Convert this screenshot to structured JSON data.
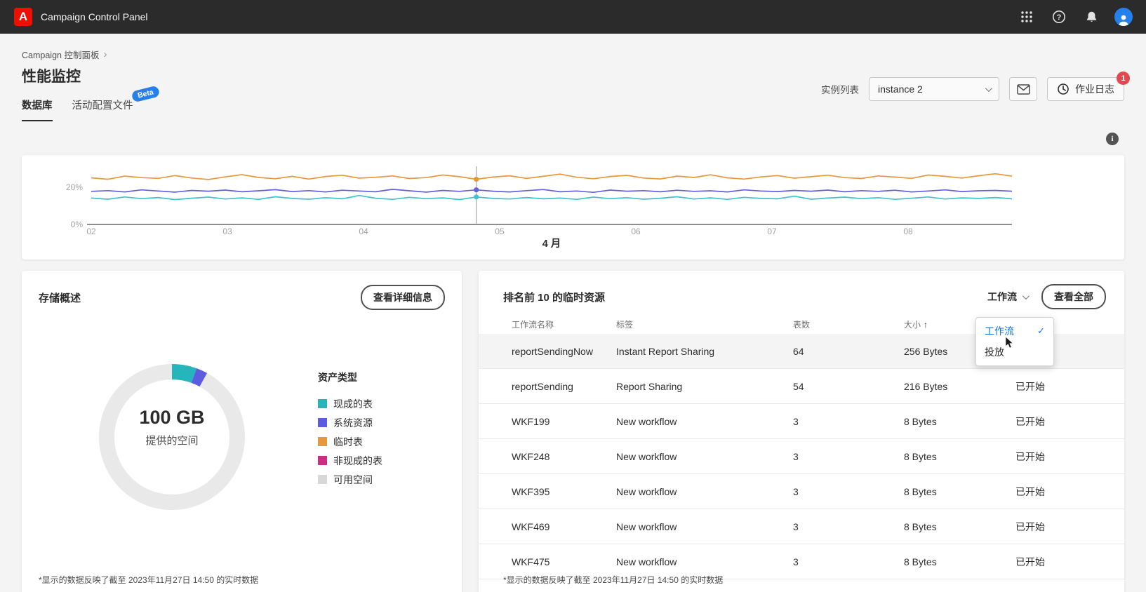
{
  "topbar": {
    "app_title": "Campaign Control Panel"
  },
  "header": {
    "breadcrumb": "Campaign 控制面板",
    "title": "性能监控",
    "tabs": [
      {
        "label": "数据库",
        "active": true
      },
      {
        "label": "活动配置文件",
        "badge": "Beta"
      }
    ],
    "instance_label": "实例列表",
    "instance_value": "instance 2",
    "jobs_button": "作业日志",
    "jobs_badge": "1"
  },
  "chart_data": {
    "type": "line",
    "xlabel": "4 月",
    "x_tick_labels": [
      "02",
      "03",
      "04",
      "05",
      "06",
      "07",
      "08"
    ],
    "y_tick_labels": [
      "20%",
      "0%"
    ],
    "y_ticks": [
      20,
      0
    ],
    "ylim": [
      0,
      30
    ],
    "grid": false,
    "legend_position": "none",
    "marker_index": 23,
    "series": [
      {
        "name": "orange",
        "color": "#E8973B",
        "values": [
          25.1,
          24.3,
          26.0,
          25.2,
          24.8,
          26.3,
          25.0,
          24.2,
          25.6,
          26.8,
          25.3,
          24.6,
          25.9,
          24.4,
          25.8,
          26.5,
          24.9,
          25.4,
          26.1,
          24.7,
          25.2,
          26.6,
          25.7,
          24.3,
          25.5,
          26.2,
          24.8,
          25.9,
          27.1,
          25.4,
          24.6,
          25.8,
          26.4,
          25.0,
          24.5,
          26.0,
          25.3,
          26.7,
          25.1,
          24.4,
          25.6,
          26.3,
          24.9,
          25.7,
          26.5,
          25.2,
          24.7,
          26.1,
          25.5,
          24.8,
          26.6,
          25.9,
          25.0,
          26.2,
          27.3,
          26.0
        ]
      },
      {
        "name": "violet",
        "color": "#6360E2",
        "values": [
          17.8,
          18.2,
          17.5,
          18.6,
          18.0,
          17.4,
          18.3,
          17.9,
          18.5,
          17.6,
          18.1,
          18.7,
          17.7,
          18.2,
          17.5,
          18.4,
          18.0,
          17.6,
          18.9,
          18.1,
          17.4,
          18.3,
          17.8,
          18.6,
          17.9,
          17.5,
          18.2,
          18.8,
          17.6,
          18.0,
          17.3,
          18.5,
          17.9,
          18.2,
          17.6,
          18.4,
          17.8,
          18.1,
          17.5,
          18.6,
          18.0,
          17.7,
          18.3,
          17.9,
          18.5,
          17.6,
          18.2,
          17.8,
          18.4,
          17.5,
          18.0,
          18.6,
          17.7,
          18.1,
          18.3,
          17.9
        ]
      },
      {
        "name": "cyan",
        "color": "#3EC3CF",
        "values": [
          14.2,
          13.6,
          14.8,
          13.9,
          14.5,
          13.4,
          14.1,
          14.7,
          13.7,
          14.3,
          13.5,
          14.9,
          14.0,
          13.6,
          14.4,
          13.8,
          15.6,
          14.1,
          13.5,
          14.6,
          13.9,
          14.3,
          13.4,
          14.8,
          14.0,
          13.7,
          14.5,
          13.8,
          14.2,
          13.5,
          14.7,
          13.9,
          14.4,
          13.6,
          14.1,
          14.9,
          13.7,
          14.3,
          13.5,
          14.6,
          14.0,
          13.8,
          15.2,
          13.6,
          14.2,
          14.7,
          13.9,
          14.4,
          13.5,
          14.1,
          14.8,
          13.7,
          14.3,
          14.0,
          14.5,
          13.8
        ]
      }
    ]
  },
  "storage": {
    "title": "存储概述",
    "details_button": "查看详细信息",
    "total_value": "100 GB",
    "total_label": "提供的空间",
    "legend_title": "资产类型",
    "segments": [
      {
        "label": "现成的表",
        "color": "#27B5BC",
        "pct": 5.5
      },
      {
        "label": "系统资源",
        "color": "#5C5CE0",
        "pct": 2.5
      },
      {
        "label": "临时表",
        "color": "#E8973B",
        "pct": 0
      },
      {
        "label": "非现成的表",
        "color": "#CE2E81",
        "pct": 0
      },
      {
        "label": "可用空间",
        "color": "#D8D8D8",
        "pct": 92,
        "remainder": true
      }
    ],
    "footnote": "*显示的数据反映了截至 2023年11月27日 14:50 的实时数据"
  },
  "resources": {
    "title": "排名前 10 的临时资源",
    "filter_label": "工作流",
    "view_all": "查看全部",
    "sort_icon": "↑",
    "columns": [
      "工作流名称",
      "标签",
      "表数",
      "大小"
    ],
    "rows": [
      {
        "name": "reportSendingNow",
        "label": "Instant Report Sharing",
        "tables": "64",
        "size": "256 Bytes",
        "status": "",
        "highlighted": true
      },
      {
        "name": "reportSending",
        "label": "Report Sharing",
        "tables": "54",
        "size": "216 Bytes",
        "status": "已开始"
      },
      {
        "name": "WKF199",
        "label": "New workflow",
        "tables": "3",
        "size": "8 Bytes",
        "status": "已开始"
      },
      {
        "name": "WKF248",
        "label": "New workflow",
        "tables": "3",
        "size": "8 Bytes",
        "status": "已开始"
      },
      {
        "name": "WKF395",
        "label": "New workflow",
        "tables": "3",
        "size": "8 Bytes",
        "status": "已开始"
      },
      {
        "name": "WKF469",
        "label": "New workflow",
        "tables": "3",
        "size": "8 Bytes",
        "status": "已开始"
      },
      {
        "name": "WKF475",
        "label": "New workflow",
        "tables": "3",
        "size": "8 Bytes",
        "status": "已开始"
      }
    ],
    "dropdown": {
      "items": [
        {
          "label": "工作流",
          "selected": true
        },
        {
          "label": "投放",
          "selected": false
        }
      ]
    },
    "footnote": "*显示的数据反映了截至 2023年11月27日 14:50 的实时数据"
  }
}
